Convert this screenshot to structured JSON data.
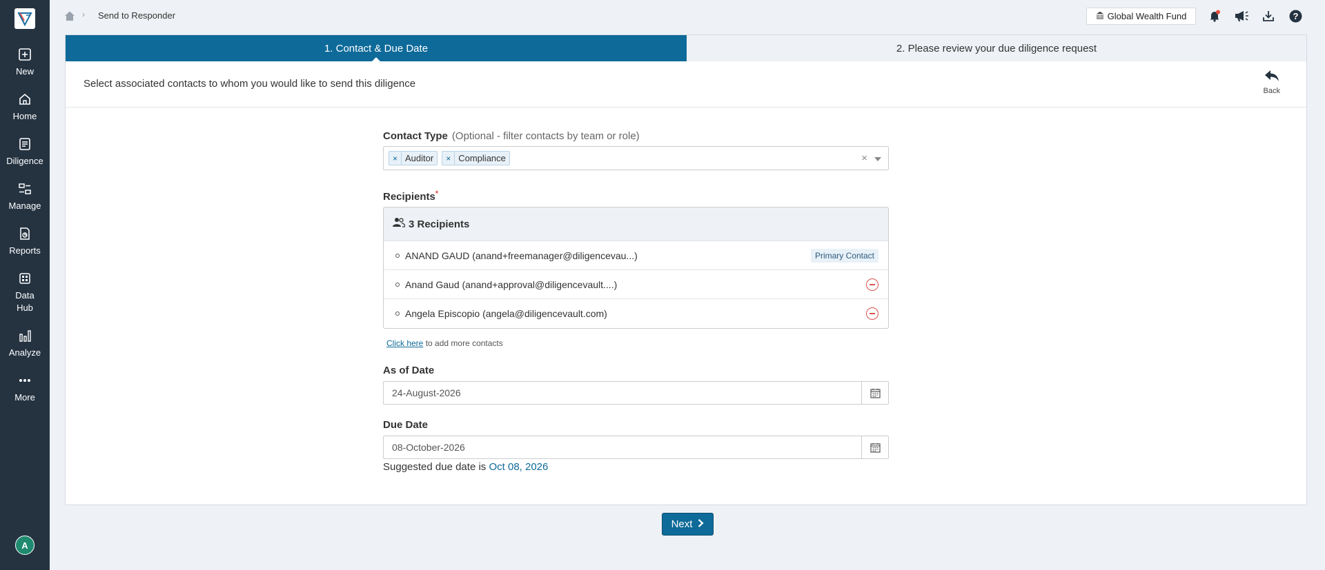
{
  "breadcrumb": {
    "current": "Send to Responder"
  },
  "header": {
    "fund_label": "Global Wealth Fund"
  },
  "sidebar": {
    "items": [
      {
        "label": "New",
        "icon": "plus-square-icon"
      },
      {
        "label": "Home",
        "icon": "home-icon"
      },
      {
        "label": "Diligence",
        "icon": "diligence-icon"
      },
      {
        "label": "Manage",
        "icon": "manage-icon"
      },
      {
        "label": "Reports",
        "icon": "reports-icon"
      },
      {
        "label": "Data Hub",
        "icon": "data-hub-icon"
      },
      {
        "label": "Analyze",
        "icon": "bar-chart-icon"
      },
      {
        "label": "More",
        "icon": "more-dots-icon"
      }
    ],
    "avatar_initial": "A"
  },
  "wizard": {
    "step1": "1. Contact & Due Date",
    "step2": "2. Please review your due diligence request"
  },
  "page": {
    "title": "Select associated contacts to whom you would like to send this diligence",
    "back_label": "Back"
  },
  "contact_type": {
    "label": "Contact Type",
    "hint": "(Optional - filter contacts by team or role)",
    "selected": [
      "Auditor",
      "Compliance"
    ]
  },
  "recipients": {
    "label": "Recipients",
    "count_label": "3 Recipients",
    "rows": [
      {
        "text": "ANAND GAUD (anand+freemanager@diligencevau...)",
        "badge": "Primary Contact"
      },
      {
        "text": "Anand Gaud (anand+approval@diligencevault....)"
      },
      {
        "text": "Angela Episcopio (angela@diligencevault.com)"
      }
    ],
    "add_link": "Click here",
    "add_suffix": "to add more contacts"
  },
  "as_of_date": {
    "label": "As of Date",
    "value": "24-August-2026"
  },
  "due_date": {
    "label": "Due Date",
    "value": "08-October-2026",
    "suggest_prefix": "Suggested due date is",
    "suggest_date": "Oct 08, 2026"
  },
  "actions": {
    "next_label": "Next"
  },
  "colors": {
    "primary": "#0e6a99",
    "sidebar": "#253341",
    "danger": "#d9534f"
  }
}
